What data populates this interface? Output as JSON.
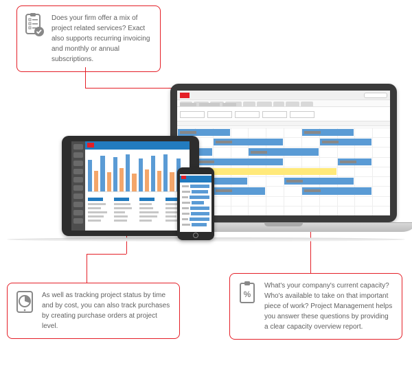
{
  "callouts": {
    "top": {
      "icon": "checklist-check-icon",
      "text": "Does your firm offer a mix of project related services? Exact also supports recurring invoicing and monthly or annual subscriptions."
    },
    "bottom_left": {
      "icon": "tablet-pie-icon",
      "text": "As well as tracking project status by time and by cost, you can also track purchases by creating purchase orders at project level."
    },
    "bottom_right": {
      "icon": "clipboard-percent-icon",
      "text": "What's your company's current capacity? Who's available to take on that important piece of work? Project Management helps you answer these questions by providing a clear capacity overview report."
    }
  },
  "laptop_app": {
    "tab_widths": [
      18,
      22,
      20,
      24,
      18,
      22,
      16,
      20,
      18
    ],
    "crumb_widths": [
      24,
      30,
      20
    ],
    "filter_count": 5,
    "gantt_cols": 12,
    "gantt_rows": 9,
    "gantt_bars": [
      {
        "row": 0,
        "start": 0,
        "span": 3,
        "cls": ""
      },
      {
        "row": 0,
        "start": 7,
        "span": 3,
        "cls": ""
      },
      {
        "row": 1,
        "start": 2,
        "span": 4,
        "cls": ""
      },
      {
        "row": 1,
        "start": 8,
        "span": 3,
        "cls": ""
      },
      {
        "row": 2,
        "start": 0,
        "span": 2,
        "cls": ""
      },
      {
        "row": 2,
        "start": 4,
        "span": 4,
        "cls": ""
      },
      {
        "row": 3,
        "start": 1,
        "span": 5,
        "cls": ""
      },
      {
        "row": 3,
        "start": 9,
        "span": 2,
        "cls": ""
      },
      {
        "row": 4,
        "start": 0,
        "span": 9,
        "cls": "y"
      },
      {
        "row": 5,
        "start": 0,
        "span": 4,
        "cls": ""
      },
      {
        "row": 5,
        "start": 6,
        "span": 4,
        "cls": ""
      },
      {
        "row": 6,
        "start": 2,
        "span": 3,
        "cls": ""
      },
      {
        "row": 6,
        "start": 7,
        "span": 4,
        "cls": ""
      }
    ]
  },
  "tablet_app": {
    "sidebar_rows": 10,
    "chart_values": [
      46,
      30,
      52,
      28,
      50,
      34,
      54,
      26,
      48,
      32,
      52,
      30,
      54,
      28,
      48,
      32
    ],
    "chart_pattern": [
      "b",
      "o",
      "b",
      "o",
      "b",
      "o",
      "b",
      "o",
      "b",
      "o",
      "b",
      "o",
      "b",
      "o",
      "b",
      "o"
    ],
    "table_cols": 4,
    "table_rows_per_col": 5
  },
  "phone_app": {
    "bars": [
      36,
      24,
      40,
      18,
      32,
      28,
      38,
      22
    ]
  }
}
